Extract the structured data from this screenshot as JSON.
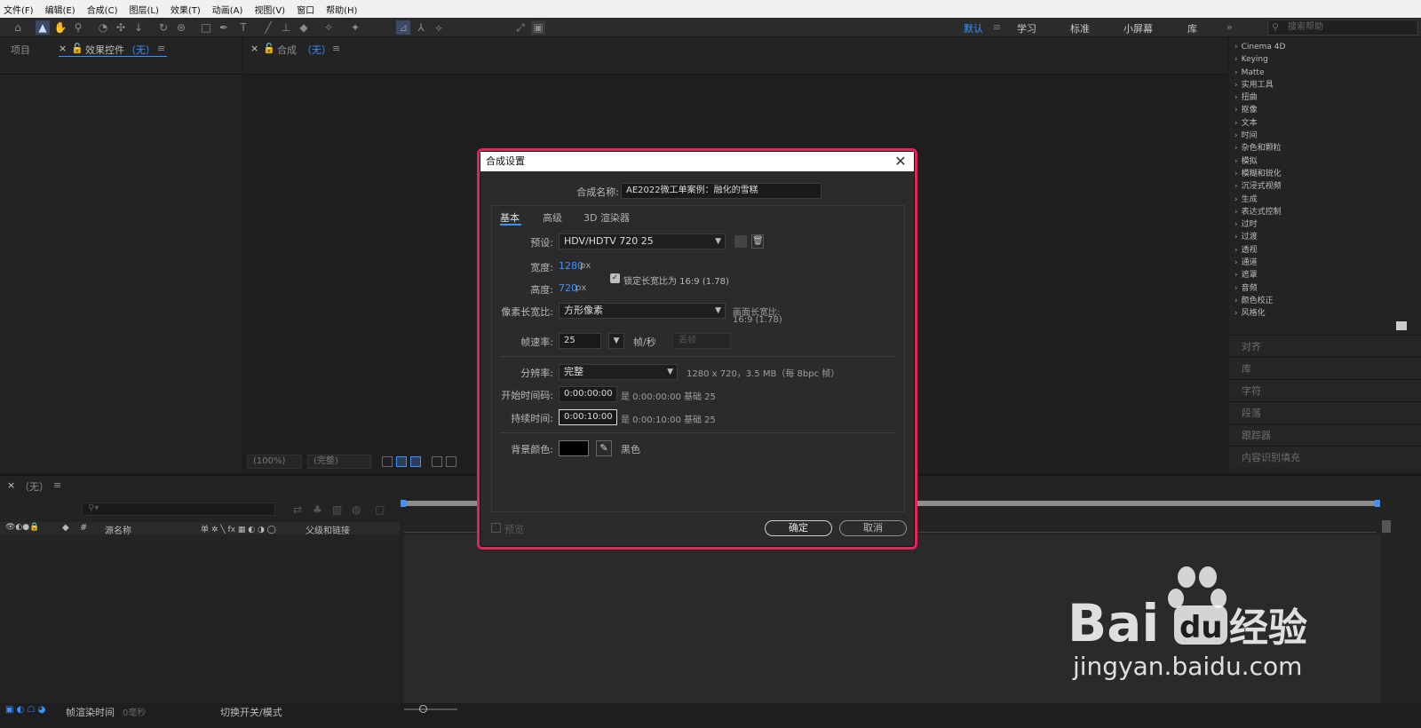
{
  "menu": [
    "文件(F)",
    "编辑(E)",
    "合成(C)",
    "图层(L)",
    "效果(T)",
    "动画(A)",
    "视图(V)",
    "窗口",
    "帮助(H)"
  ],
  "toolbar": {
    "align_label": "对齐"
  },
  "workspaces": {
    "items": [
      "默认",
      "学习",
      "标准",
      "小屏幕",
      "库"
    ],
    "active": "默认",
    "more": "»"
  },
  "search_help": {
    "placeholder": "搜索帮助"
  },
  "left_panel": {
    "tab1": "项目",
    "tab2": "效果控件",
    "tab2_suffix": "（无）",
    "menu_icon": "≡"
  },
  "comp_panel": {
    "tab": "合成",
    "tab_suffix": "（无）",
    "zoom": "(100%)",
    "quality": "(完整)"
  },
  "effects": [
    "Cinema 4D",
    "Keying",
    "Matte",
    "实用工具",
    "扭曲",
    "抠像",
    "文本",
    "时间",
    "杂色和颗粒",
    "模拟",
    "模糊和锐化",
    "沉浸式视频",
    "生成",
    "表达式控制",
    "过时",
    "过渡",
    "透视",
    "通道",
    "遮罩",
    "音频",
    "颜色校正",
    "风格化"
  ],
  "right_panels": [
    "对齐",
    "库",
    "字符",
    "段落",
    "跟踪器",
    "内容识别填充"
  ],
  "timeline": {
    "tab": "（无）",
    "columns": {
      "source_name": "源名称",
      "switches": "单 ✲ ╲ fx ▦ ◐ ◑ ◯",
      "parent": "父级和链接"
    },
    "footer": {
      "render_time": "帧渲染时间",
      "render_value": "0毫秒",
      "toggle_mode": "切换开关/模式"
    }
  },
  "dialog": {
    "title": "合成设置",
    "comp_name_label": "合成名称:",
    "comp_name_value": "AE2022微工单案例：融化的雪糕",
    "tabs": [
      "基本",
      "高级",
      "3D 渲染器"
    ],
    "active_tab": "基本",
    "preset_label": "预设:",
    "preset_value": "HDV/HDTV 720 25",
    "width_label": "宽度:",
    "width_value": "1280",
    "height_label": "高度:",
    "height_value": "720",
    "px": "px",
    "lock_label": "锁定长宽比为 16:9 (1.78)",
    "lock_checked": true,
    "pixel_aspect_label": "像素长宽比:",
    "pixel_aspect_value": "方形像素",
    "frame_aspect_label": "画面长宽比:",
    "frame_aspect_value": "16:9 (1.78)",
    "frame_rate_label": "帧速率:",
    "frame_rate_value": "25",
    "fps_unit": "帧/秒",
    "drop_frame": "丢帧",
    "resolution_label": "分辨率:",
    "resolution_value": "完整",
    "resolution_info": "1280 x 720，3.5 MB（每 8bpc 帧）",
    "start_tc_label": "开始时间码:",
    "start_tc_value": "0:00:00:00",
    "start_tc_info": "是 0:00:00:00  基础 25",
    "duration_label": "持续时间:",
    "duration_value": "0:00:10:00",
    "duration_info": "是 0:00:10:00  基础 25",
    "bg_label": "背景颜色:",
    "bg_color": "#000000",
    "bg_name": "黑色",
    "preview_label": "预览",
    "ok": "确定",
    "cancel": "取消",
    "highlight_color": "#e0255b",
    "accent_color": "#3a92ff"
  },
  "watermark": {
    "brand": "Bai",
    "brand2": "经验",
    "url": "jingyan.baidu.com"
  }
}
